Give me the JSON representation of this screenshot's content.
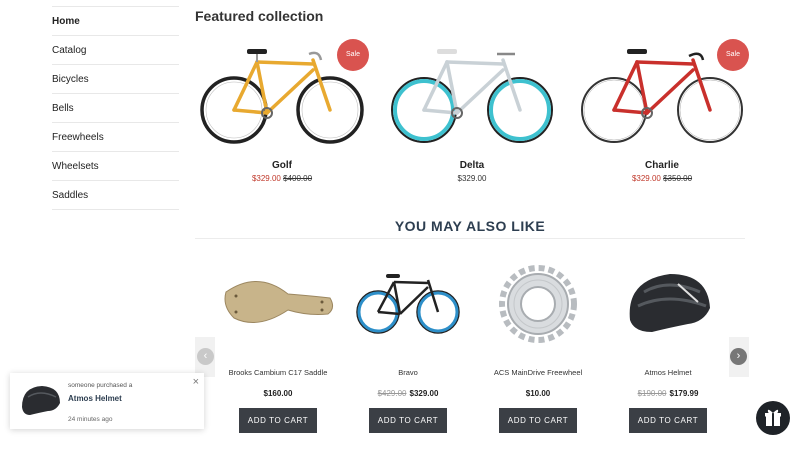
{
  "sidebar": {
    "items": [
      {
        "label": "Home"
      },
      {
        "label": "Catalog"
      },
      {
        "label": "Bicycles"
      },
      {
        "label": "Bells"
      },
      {
        "label": "Freewheels"
      },
      {
        "label": "Wheelsets"
      },
      {
        "label": "Saddles"
      }
    ]
  },
  "featured": {
    "title": "Featured collection",
    "products": [
      {
        "name": "Golf",
        "sale_price": "$329.00",
        "old_price": "$400.00",
        "badge": "Sale",
        "frame_color": "#e8a930",
        "rim_color": "#222222"
      },
      {
        "name": "Delta",
        "price": "$329.00",
        "frame_color": "#c9d1d6",
        "rim_color": "#3ec1cf"
      },
      {
        "name": "Charlie",
        "sale_price": "$329.00",
        "old_price": "$350.00",
        "badge": "Sale",
        "frame_color": "#c9302c",
        "rim_color": "#222222"
      }
    ]
  },
  "also_like": {
    "title": "YOU MAY ALSO LIKE",
    "products": [
      {
        "name": "Brooks Cambium C17 Saddle",
        "price": "$160.00",
        "button": "ADD TO CART"
      },
      {
        "name": "Bravo",
        "old_price": "$429.00",
        "price": "$329.00",
        "button": "ADD TO CART"
      },
      {
        "name": "ACS MainDrive Freewheel",
        "price": "$10.00",
        "button": "ADD TO CART"
      },
      {
        "name": "Atmos Helmet",
        "old_price": "$190.00",
        "price": "$179.99",
        "button": "ADD TO CART"
      }
    ],
    "prev_icon": "chevron-left-icon",
    "next_icon": "chevron-right-icon"
  },
  "notification": {
    "line1": "someone purchased a",
    "product": "Atmos Helmet",
    "time": "24 minutes ago",
    "close": "×"
  },
  "gift_icon": "gift-icon",
  "colors": {
    "sale": "#c0392b",
    "badge": "#d9534f",
    "button": "#3b3f45",
    "heading": "#2d3e50"
  }
}
